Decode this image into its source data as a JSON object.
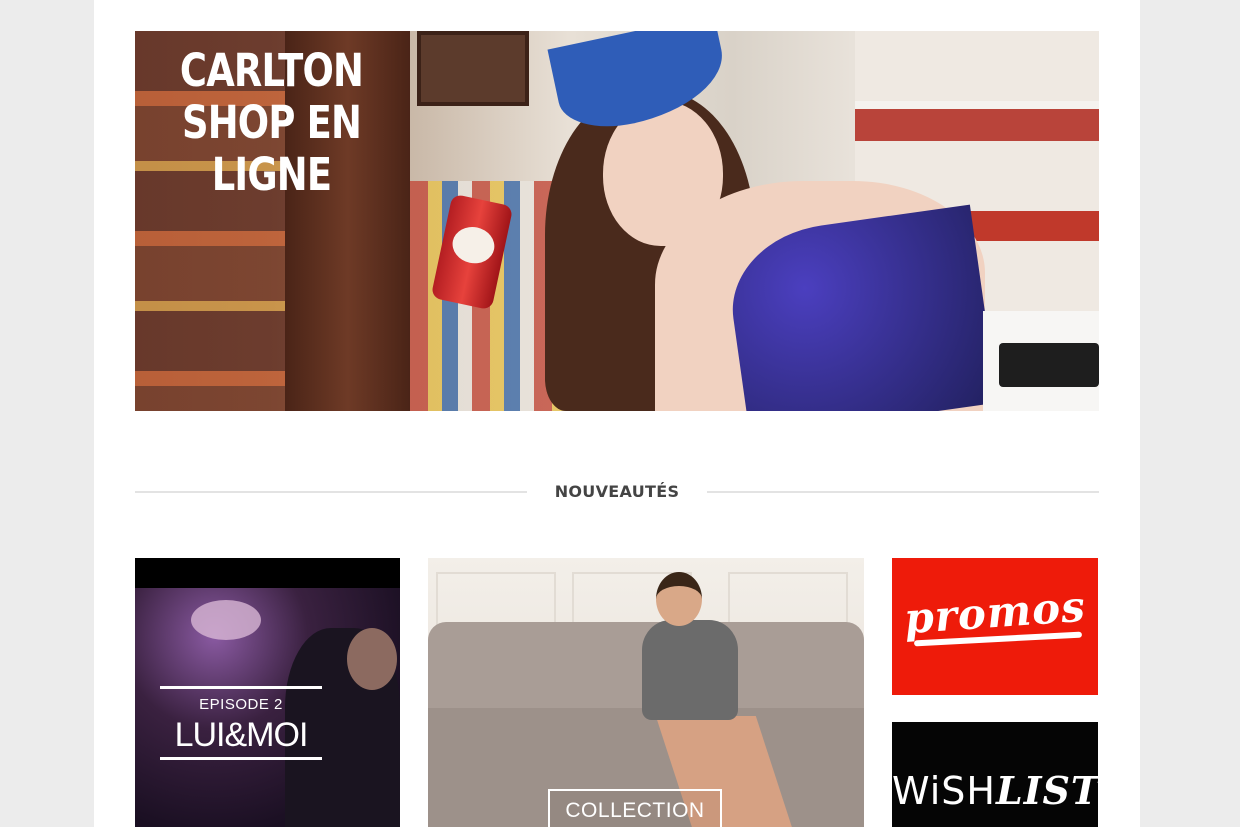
{
  "hero": {
    "title_line1": "CARLTON",
    "title_line2": "SHOP EN LIGNE"
  },
  "section": {
    "heading": "NOUVEAUTÉS"
  },
  "tiles": {
    "episode": {
      "kicker": "EPISODE 2",
      "title": "LUI&MOI"
    },
    "collection": {
      "button_label": "COLLECTION"
    },
    "promos": {
      "label": "promos"
    },
    "wishlist": {
      "label_part1": "WiSH",
      "label_part2": "LIST"
    }
  },
  "colors": {
    "page_bg": "#ececec",
    "content_bg": "#ffffff",
    "promos_red": "#ee1b0a",
    "wishlist_black": "#050505",
    "heading_text": "#444444"
  }
}
